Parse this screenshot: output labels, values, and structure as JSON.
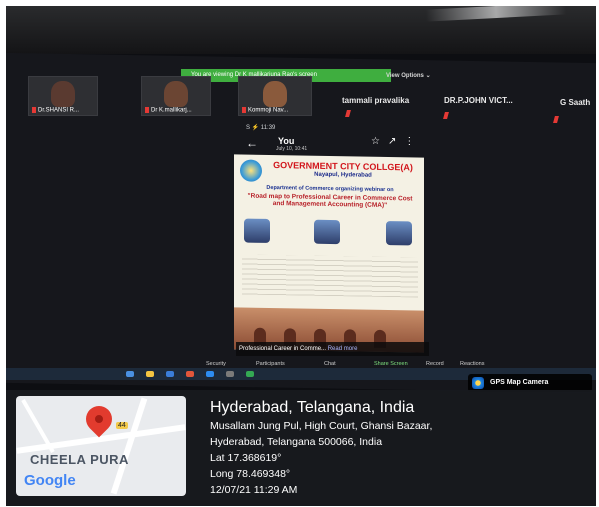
{
  "zoom": {
    "banner": "You are viewing Dr K mallikarjuna Rao's screen",
    "view_options": "View Options ⌄",
    "participants": [
      {
        "name": "Dr.SHANSI R..."
      },
      {
        "name": "Dr K.mallikarj..."
      },
      {
        "name": "Kommoji Nav..."
      }
    ],
    "name_row": [
      "tammali pravalika",
      "DR.P.JOHN VICT...",
      "G Saath"
    ],
    "toolbar": [
      "Security",
      "Participants",
      "Chat",
      "Share Screen",
      "Record",
      "Reactions"
    ]
  },
  "phone": {
    "status": "S ⚡ 11:39",
    "sender": "You",
    "date": "July 10, 10:41",
    "caption_text": "Professional Career in Comme...",
    "caption_more": "Read more"
  },
  "poster": {
    "title": "GOVERNMENT CITY COLLGE(A)",
    "subtitle": "Nayapul, Hyderabad",
    "department": "Department of Commerce organizing webinar on",
    "webinar_title": "\"Road map to Professional Career in Commerce Cost and Management Accounting (CMA)\""
  },
  "gps": {
    "app_label": "GPS Map Camera",
    "map_marker": "44",
    "map_area": "CHEELA PURA",
    "map_brand": "Google",
    "city": "Hyderabad, Telangana, India",
    "address_1": "Musallam Jung Pul, High Court, Ghansi Bazaar,",
    "address_2": "Hyderabad, Telangana 500066, India",
    "lat": "Lat 17.368619°",
    "long": "Long 78.469348°",
    "datetime": "12/07/21 11:29 AM"
  },
  "colors": {
    "zoom_green": "#3fae3f",
    "poster_red": "#d2151b",
    "poster_blue": "#1b2a8a",
    "pin_red": "#e23b2e"
  }
}
